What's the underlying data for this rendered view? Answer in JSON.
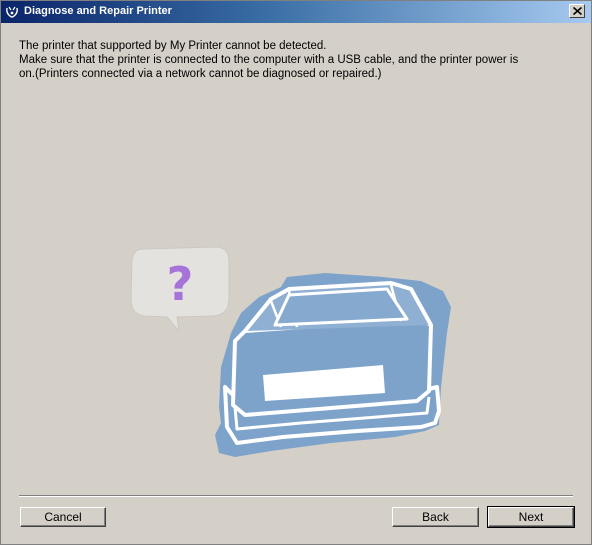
{
  "window": {
    "title": "Diagnose and Repair Printer"
  },
  "message": {
    "line1": "The printer that supported by My Printer cannot be detected.",
    "line2": "Make sure that the printer is connected to the computer with a USB cable, and the printer power is",
    "line3": "on.(Printers connected via a network cannot be diagnosed or repaired.)"
  },
  "illustration": {
    "bubble_symbol": "?",
    "bubble_icon": "speech-bubble-question-icon",
    "printer_icon": "printer-icon",
    "colors": {
      "printer_fill": "#7ea3cb",
      "printer_outline": "#ffffff",
      "bubble_fill": "#e4e2df",
      "question_mark": "#a673d9"
    }
  },
  "buttons": {
    "cancel_label": "Cancel",
    "back_label": "Back",
    "next_label": "Next"
  },
  "colors": {
    "window_bg": "#d4d0c8",
    "titlebar_start": "#0a246a",
    "titlebar_end": "#a6caf0"
  }
}
